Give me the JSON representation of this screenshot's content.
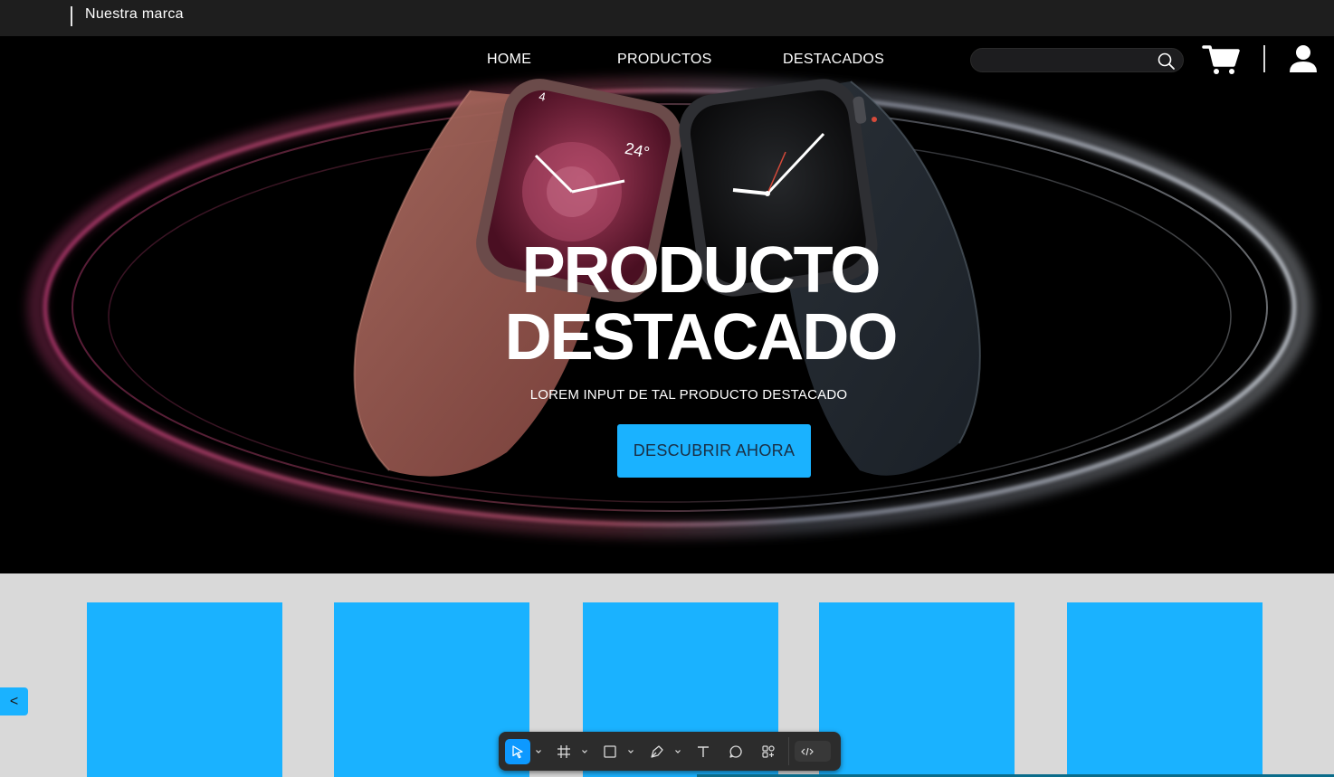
{
  "brand": {
    "name": "Nuestra marca"
  },
  "nav": {
    "home": "HOME",
    "products": "PRODUCTOS",
    "featured": "DESTACADOS"
  },
  "search": {
    "value": "",
    "placeholder": "",
    "icon": "search-icon"
  },
  "header_icons": {
    "cart": "cart-icon",
    "user": "user-icon"
  },
  "hero": {
    "title_line1": "PRODUCTO",
    "title_line2": "DESTACADO",
    "subtitle": "LOREM INPUT DE TAL PRODUCTO DESTACADO",
    "cta": "DESCUBRIR AHORA"
  },
  "carousel": {
    "prev_label": "<",
    "card_count": 5
  },
  "toolbar": {
    "tools": [
      "move-tool-icon",
      "frame-tool-icon",
      "rectangle-tool-icon",
      "pen-tool-icon",
      "text-tool-icon",
      "comment-tool-icon",
      "components-tool-icon",
      "dev-mode-icon"
    ],
    "active": "move-tool-icon"
  },
  "colors": {
    "accent": "#1ab2ff",
    "topbar": "#1e1e1e",
    "hero_bg": "#000000",
    "section_bg": "#d9d9d9",
    "cta_text": "#1a2f45",
    "toolbar_active": "#0d99ff"
  }
}
